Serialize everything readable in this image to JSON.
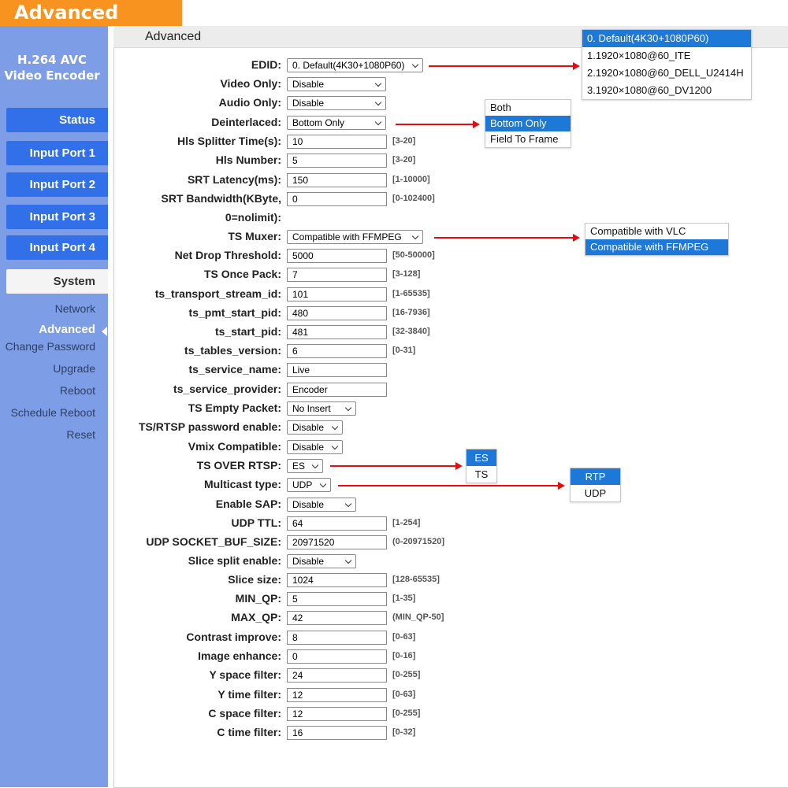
{
  "app": {
    "title": "Advanced",
    "brand_line1": "H.264 AVC",
    "brand_line2": "Video Encoder"
  },
  "nav": {
    "buttons": [
      "Status",
      "Input Port 1",
      "Input Port 2",
      "Input Port 3",
      "Input Port 4",
      "System"
    ],
    "sublinks": [
      "Network",
      "Advanced",
      "Change Password",
      "Upgrade",
      "Reboot",
      "Schedule Reboot",
      "Reset"
    ],
    "active": "Advanced"
  },
  "panel": {
    "title": "Advanced"
  },
  "fields": [
    {
      "label": "EDID:",
      "value": "0. Default(4K30+1080P60)",
      "kind": "select",
      "range": ""
    },
    {
      "label": "Video Only:",
      "value": "Disable",
      "kind": "select",
      "range": ""
    },
    {
      "label": "Audio Only:",
      "value": "Disable",
      "kind": "select",
      "range": ""
    },
    {
      "label": "Deinterlaced:",
      "value": "Bottom Only",
      "kind": "select",
      "range": ""
    },
    {
      "label": "Hls Splitter Time(s):",
      "value": "10",
      "kind": "text",
      "range": "[3-20]"
    },
    {
      "label": "Hls Number:",
      "value": "5",
      "kind": "text",
      "range": "[3-20]"
    },
    {
      "label": "SRT Latency(ms):",
      "value": "150",
      "kind": "text",
      "range": "[1-10000]"
    },
    {
      "label": "SRT Bandwidth(KByte,",
      "value": "0",
      "kind": "text",
      "range": "[0-102400]"
    },
    {
      "label": "0=nolimit):",
      "value": "",
      "kind": "none",
      "range": ""
    },
    {
      "label": "TS Muxer:",
      "value": "Compatible with FFMPEG",
      "kind": "select",
      "range": ""
    },
    {
      "label": "Net Drop Threshold:",
      "value": "5000",
      "kind": "text",
      "range": "[50-50000]"
    },
    {
      "label": "TS Once Pack:",
      "value": "7",
      "kind": "text",
      "range": "[3-128]"
    },
    {
      "label": "ts_transport_stream_id:",
      "value": "101",
      "kind": "text",
      "range": "[1-65535]"
    },
    {
      "label": "ts_pmt_start_pid:",
      "value": "480",
      "kind": "text",
      "range": "[16-7936]"
    },
    {
      "label": "ts_start_pid:",
      "value": "481",
      "kind": "text",
      "range": "[32-3840]"
    },
    {
      "label": "ts_tables_version:",
      "value": "6",
      "kind": "text",
      "range": "[0-31]"
    },
    {
      "label": "ts_service_name:",
      "value": "Live",
      "kind": "text",
      "range": ""
    },
    {
      "label": "ts_service_provider:",
      "value": "Encoder",
      "kind": "text",
      "range": ""
    },
    {
      "label": "TS Empty Packet:",
      "value": "No Insert",
      "kind": "select",
      "range": ""
    },
    {
      "label": "TS/RTSP password enable:",
      "value": "Disable",
      "kind": "select",
      "range": ""
    },
    {
      "label": "Vmix Compatible:",
      "value": "Disable",
      "kind": "select",
      "range": ""
    },
    {
      "label": "TS OVER RTSP:",
      "value": "ES",
      "kind": "select",
      "range": ""
    },
    {
      "label": "Multicast type:",
      "value": "UDP",
      "kind": "select",
      "range": ""
    },
    {
      "label": "Enable SAP:",
      "value": "Disable",
      "kind": "select",
      "range": ""
    },
    {
      "label": "UDP TTL:",
      "value": "64",
      "kind": "text",
      "range": "[1-254]"
    },
    {
      "label": "UDP SOCKET_BUF_SIZE:",
      "value": "20971520",
      "kind": "text",
      "range": "(0-20971520]"
    },
    {
      "label": "Slice split enable:",
      "value": "Disable",
      "kind": "select",
      "range": ""
    },
    {
      "label": "Slice size:",
      "value": "1024",
      "kind": "text",
      "range": "[128-65535]"
    },
    {
      "label": "MIN_QP:",
      "value": "5",
      "kind": "text",
      "range": "[1-35]"
    },
    {
      "label": "MAX_QP:",
      "value": "42",
      "kind": "text",
      "range": "(MIN_QP-50]"
    },
    {
      "label": "Contrast improve:",
      "value": "8",
      "kind": "text",
      "range": "[0-63]"
    },
    {
      "label": "Image enhance:",
      "value": "0",
      "kind": "text",
      "range": "[0-16]"
    },
    {
      "label": "Y space filter:",
      "value": "24",
      "kind": "text",
      "range": "[0-255]"
    },
    {
      "label": "Y time filter:",
      "value": "12",
      "kind": "text",
      "range": "[0-63]"
    },
    {
      "label": "C space filter:",
      "value": "12",
      "kind": "text",
      "range": "[0-255]"
    },
    {
      "label": "C time filter:",
      "value": "16",
      "kind": "text",
      "range": "[0-32]"
    }
  ],
  "dropdowns": {
    "edid": {
      "options": [
        "0. Default(4K30+1080P60)",
        "1.1920×1080@60_ITE",
        "2.1920×1080@60_DELL_U2414H",
        "3.1920×1080@60_DV1200"
      ],
      "highlight": 0
    },
    "deinterlaced": {
      "options": [
        "Both",
        "Bottom Only",
        "Field To Frame"
      ],
      "highlight": 1
    },
    "ts_muxer": {
      "options": [
        "Compatible with VLC",
        "Compatible with FFMPEG"
      ],
      "highlight": 1
    },
    "ts_over_rtsp": {
      "options": [
        "ES",
        "TS"
      ],
      "highlight": 0
    },
    "multicast": {
      "options": [
        "RTP",
        "UDP"
      ],
      "highlight": 0
    }
  },
  "colors": {
    "accent": "#f7931e",
    "sidebar": "#7d9de6",
    "nav_button": "#3170e8",
    "highlight": "#1d78d8",
    "arrow": "#e01010"
  }
}
